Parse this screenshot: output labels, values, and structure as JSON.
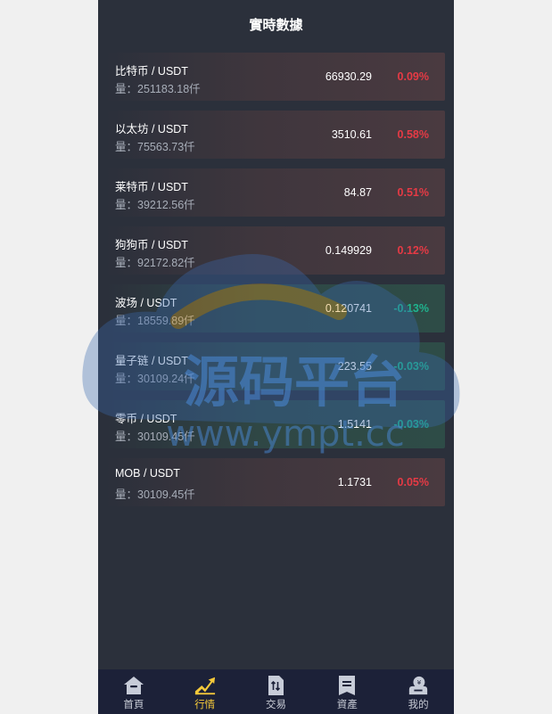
{
  "header": {
    "title": "實時數據"
  },
  "volume_prefix": "量：",
  "markets": [
    {
      "pair": "比特币 / USDT",
      "volume": "251183.18仟",
      "price": "66930.29",
      "change": "0.09%",
      "trend": "up"
    },
    {
      "pair": "以太坊 / USDT",
      "volume": "75563.73仟",
      "price": "3510.61",
      "change": "0.58%",
      "trend": "up"
    },
    {
      "pair": "莱特币 / USDT",
      "volume": "39212.56仟",
      "price": "84.87",
      "change": "0.51%",
      "trend": "up"
    },
    {
      "pair": "狗狗币 / USDT",
      "volume": "92172.82仟",
      "price": "0.149929",
      "change": "0.12%",
      "trend": "up"
    },
    {
      "pair": "波场 / USDT",
      "volume": "18559.89仟",
      "price": "0.120741",
      "change": "-0.13%",
      "trend": "down"
    },
    {
      "pair": "量子链 / USDT",
      "volume": "30109.24仟",
      "price": "223.55",
      "change": "-0.03%",
      "trend": "down"
    },
    {
      "pair": "零币 / USDT",
      "volume": "30109.45仟",
      "price": "1.5141",
      "change": "-0.03%",
      "trend": "down"
    },
    {
      "pair": "MOB / USDT",
      "volume": "30109.45仟",
      "price": "1.1731",
      "change": "0.05%",
      "trend": "up"
    }
  ],
  "tabbar": {
    "items": [
      {
        "label": "首頁",
        "icon": "home-icon"
      },
      {
        "label": "行情",
        "icon": "chart-trend-icon",
        "active": true
      },
      {
        "label": "交易",
        "icon": "exchange-icon"
      },
      {
        "label": "資產",
        "icon": "assets-icon"
      },
      {
        "label": "我的",
        "icon": "wallet-user-icon"
      }
    ]
  },
  "watermark": {
    "brand": "源码平台",
    "url": "www.ympt.cc"
  },
  "colors": {
    "background": "#2b303b",
    "up": "#e63a45",
    "down": "#1fb38e",
    "tab_active": "#f5c93a",
    "tabbar": "#1c2138"
  }
}
